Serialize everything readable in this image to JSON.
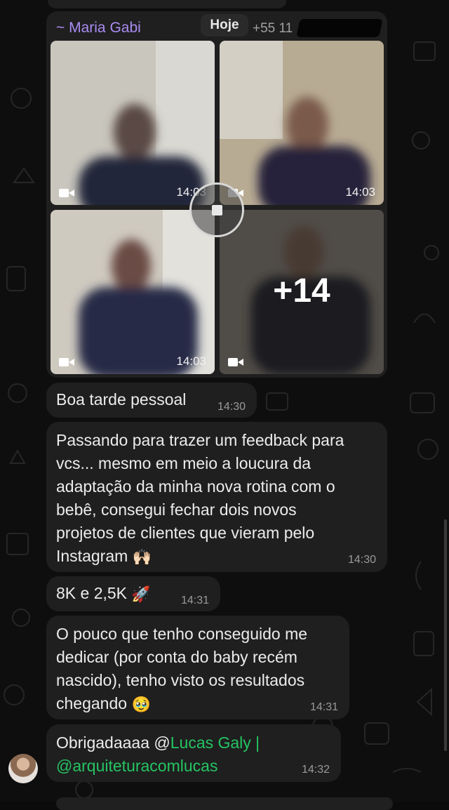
{
  "chat": {
    "sender_name": "~ Maria Gabi",
    "date_badge": "Hoje",
    "phone_prefix": "+55 11"
  },
  "media": {
    "thumb_times": [
      "14:03",
      "14:03",
      "14:03"
    ],
    "more_count": "+14",
    "icons": [
      "video-camera-icon",
      "stop-download-icon"
    ]
  },
  "messages": [
    {
      "text": "Boa tarde pessoal",
      "time": "14:30"
    },
    {
      "text": "Passando para trazer um feedback para\nvcs... mesmo em meio a loucura da\nadaptação da minha nova rotina com o\nbebê, consegui fechar dois novos\nprojetos de clientes que vieram pelo\nInstagram",
      "emoji": "🙌🏻",
      "time": "14:30"
    },
    {
      "text": "8K e 2,5K",
      "emoji": "🚀",
      "time": "14:31"
    },
    {
      "text": "O pouco que tenho conseguido me\ndedicar (por conta do baby recém\nnascido), tenho visto os resultados\nchegando",
      "emoji": "🥹",
      "time": "14:31"
    },
    {
      "prefix": "Obrigadaaaa @",
      "mention_line1": "Lucas Galy |",
      "mention_line2": "@arquiteturacomlucas",
      "time": "14:32"
    }
  ],
  "colors": {
    "sender_name": "#a98cf2",
    "mention": "#25c463",
    "bubble": "#1f1f1f"
  }
}
